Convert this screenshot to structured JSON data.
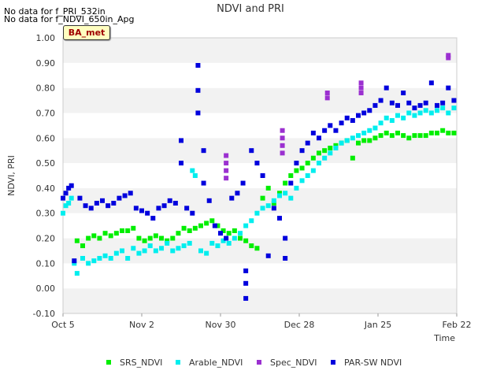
{
  "messages": [
    "No data for f_PRI_532in",
    "No data for f_NDVI_650in_Apg"
  ],
  "badge": "BA_met",
  "chart_data": {
    "type": "scatter",
    "title": "NDVI and PRI",
    "xlabel": "Time",
    "ylabel": "NDVI, PRI",
    "x_range": [
      "2023-10-05",
      "2024-02-22"
    ],
    "x_tick_labels": [
      "Oct 5",
      "Nov 2",
      "Nov 30",
      "Dec 28",
      "Jan 25",
      "Feb 22"
    ],
    "ylim": [
      -0.1,
      1.0
    ],
    "y_ticks": [
      -0.1,
      0.0,
      0.1,
      0.2,
      0.3,
      0.4,
      0.5,
      0.6,
      0.7,
      0.8,
      0.9,
      1.0
    ],
    "y_tick_labels": [
      "-0.10",
      "0.00",
      "0.10",
      "0.20",
      "0.30",
      "0.40",
      "0.50",
      "0.60",
      "0.70",
      "0.80",
      "0.90",
      "1.00"
    ],
    "grid": "horizontal bands",
    "legend_position": "bottom",
    "series": [
      {
        "name": "SRS_NDVI",
        "color": "#00ee00",
        "points": [
          [
            "2023-10-10",
            0.19
          ],
          [
            "2023-10-12",
            0.17
          ],
          [
            "2023-10-14",
            0.2
          ],
          [
            "2023-10-16",
            0.21
          ],
          [
            "2023-10-18",
            0.2
          ],
          [
            "2023-10-20",
            0.22
          ],
          [
            "2023-10-22",
            0.21
          ],
          [
            "2023-10-24",
            0.22
          ],
          [
            "2023-10-26",
            0.23
          ],
          [
            "2023-10-28",
            0.23
          ],
          [
            "2023-10-30",
            0.24
          ],
          [
            "2023-11-01",
            0.2
          ],
          [
            "2023-11-03",
            0.19
          ],
          [
            "2023-11-05",
            0.2
          ],
          [
            "2023-11-07",
            0.21
          ],
          [
            "2023-11-09",
            0.2
          ],
          [
            "2023-11-11",
            0.19
          ],
          [
            "2023-11-13",
            0.2
          ],
          [
            "2023-11-15",
            0.22
          ],
          [
            "2023-11-17",
            0.24
          ],
          [
            "2023-11-19",
            0.23
          ],
          [
            "2023-11-21",
            0.24
          ],
          [
            "2023-11-23",
            0.25
          ],
          [
            "2023-11-25",
            0.26
          ],
          [
            "2023-11-27",
            0.27
          ],
          [
            "2023-11-29",
            0.25
          ],
          [
            "2023-12-01",
            0.23
          ],
          [
            "2023-12-03",
            0.22
          ],
          [
            "2023-12-05",
            0.23
          ],
          [
            "2023-12-07",
            0.2
          ],
          [
            "2023-12-09",
            0.19
          ],
          [
            "2023-12-11",
            0.17
          ],
          [
            "2023-12-13",
            0.16
          ],
          [
            "2023-12-15",
            0.36
          ],
          [
            "2023-12-17",
            0.4
          ],
          [
            "2023-12-19",
            0.34
          ],
          [
            "2023-12-21",
            0.38
          ],
          [
            "2023-12-23",
            0.42
          ],
          [
            "2023-12-25",
            0.45
          ],
          [
            "2023-12-27",
            0.47
          ],
          [
            "2023-12-29",
            0.48
          ],
          [
            "2023-12-31",
            0.5
          ],
          [
            "2024-01-02",
            0.52
          ],
          [
            "2024-01-04",
            0.54
          ],
          [
            "2024-01-06",
            0.55
          ],
          [
            "2024-01-08",
            0.56
          ],
          [
            "2024-01-10",
            0.57
          ],
          [
            "2024-01-12",
            0.58
          ],
          [
            "2024-01-14",
            0.59
          ],
          [
            "2024-01-16",
            0.52
          ],
          [
            "2024-01-18",
            0.58
          ],
          [
            "2024-01-20",
            0.59
          ],
          [
            "2024-01-22",
            0.59
          ],
          [
            "2024-01-24",
            0.6
          ],
          [
            "2024-01-26",
            0.61
          ],
          [
            "2024-01-28",
            0.62
          ],
          [
            "2024-01-30",
            0.61
          ],
          [
            "2024-02-01",
            0.62
          ],
          [
            "2024-02-03",
            0.61
          ],
          [
            "2024-02-05",
            0.6
          ],
          [
            "2024-02-07",
            0.61
          ],
          [
            "2024-02-09",
            0.61
          ],
          [
            "2024-02-11",
            0.61
          ],
          [
            "2024-02-13",
            0.62
          ],
          [
            "2024-02-15",
            0.62
          ],
          [
            "2024-02-17",
            0.63
          ],
          [
            "2024-02-19",
            0.62
          ],
          [
            "2024-02-21",
            0.62
          ]
        ]
      },
      {
        "name": "Arable_NDVI",
        "color": "#00eeee",
        "points": [
          [
            "2023-10-05",
            0.3
          ],
          [
            "2023-10-06",
            0.33
          ],
          [
            "2023-10-07",
            0.34
          ],
          [
            "2023-10-08",
            0.36
          ],
          [
            "2023-10-09",
            0.1
          ],
          [
            "2023-10-10",
            0.06
          ],
          [
            "2023-10-12",
            0.12
          ],
          [
            "2023-10-14",
            0.1
          ],
          [
            "2023-10-16",
            0.11
          ],
          [
            "2023-10-18",
            0.12
          ],
          [
            "2023-10-20",
            0.13
          ],
          [
            "2023-10-22",
            0.12
          ],
          [
            "2023-10-24",
            0.14
          ],
          [
            "2023-10-26",
            0.15
          ],
          [
            "2023-10-28",
            0.12
          ],
          [
            "2023-10-30",
            0.16
          ],
          [
            "2023-11-01",
            0.14
          ],
          [
            "2023-11-03",
            0.15
          ],
          [
            "2023-11-05",
            0.17
          ],
          [
            "2023-11-07",
            0.15
          ],
          [
            "2023-11-09",
            0.16
          ],
          [
            "2023-11-11",
            0.18
          ],
          [
            "2023-11-13",
            0.15
          ],
          [
            "2023-11-15",
            0.16
          ],
          [
            "2023-11-17",
            0.17
          ],
          [
            "2023-11-19",
            0.18
          ],
          [
            "2023-11-20",
            0.47
          ],
          [
            "2023-11-21",
            0.45
          ],
          [
            "2023-11-23",
            0.15
          ],
          [
            "2023-11-25",
            0.14
          ],
          [
            "2023-11-27",
            0.18
          ],
          [
            "2023-11-29",
            0.17
          ],
          [
            "2023-12-01",
            0.19
          ],
          [
            "2023-12-03",
            0.18
          ],
          [
            "2023-12-05",
            0.2
          ],
          [
            "2023-12-07",
            0.22
          ],
          [
            "2023-12-09",
            0.25
          ],
          [
            "2023-12-11",
            0.27
          ],
          [
            "2023-12-13",
            0.3
          ],
          [
            "2023-12-15",
            0.32
          ],
          [
            "2023-12-17",
            0.33
          ],
          [
            "2023-12-19",
            0.35
          ],
          [
            "2023-12-21",
            0.37
          ],
          [
            "2023-12-23",
            0.38
          ],
          [
            "2023-12-25",
            0.36
          ],
          [
            "2023-12-27",
            0.4
          ],
          [
            "2023-12-29",
            0.43
          ],
          [
            "2023-12-31",
            0.45
          ],
          [
            "2024-01-02",
            0.47
          ],
          [
            "2024-01-04",
            0.5
          ],
          [
            "2024-01-06",
            0.52
          ],
          [
            "2024-01-08",
            0.54
          ],
          [
            "2024-01-10",
            0.56
          ],
          [
            "2024-01-12",
            0.58
          ],
          [
            "2024-01-14",
            0.59
          ],
          [
            "2024-01-16",
            0.6
          ],
          [
            "2024-01-18",
            0.61
          ],
          [
            "2024-01-20",
            0.62
          ],
          [
            "2024-01-22",
            0.63
          ],
          [
            "2024-01-24",
            0.64
          ],
          [
            "2024-01-26",
            0.66
          ],
          [
            "2024-01-28",
            0.68
          ],
          [
            "2024-01-30",
            0.67
          ],
          [
            "2024-02-01",
            0.69
          ],
          [
            "2024-02-03",
            0.68
          ],
          [
            "2024-02-05",
            0.7
          ],
          [
            "2024-02-07",
            0.69
          ],
          [
            "2024-02-09",
            0.7
          ],
          [
            "2024-02-11",
            0.71
          ],
          [
            "2024-02-13",
            0.7
          ],
          [
            "2024-02-15",
            0.71
          ],
          [
            "2024-02-17",
            0.72
          ],
          [
            "2024-02-19",
            0.7
          ],
          [
            "2024-02-21",
            0.72
          ]
        ]
      },
      {
        "name": "Spec_NDVI",
        "color": "#9b30d0",
        "points": [
          [
            "2023-12-02",
            0.53
          ],
          [
            "2023-12-02",
            0.5
          ],
          [
            "2023-12-02",
            0.47
          ],
          [
            "2023-12-02",
            0.44
          ],
          [
            "2023-12-22",
            0.63
          ],
          [
            "2023-12-22",
            0.6
          ],
          [
            "2023-12-22",
            0.57
          ],
          [
            "2023-12-22",
            0.54
          ],
          [
            "2024-01-07",
            0.78
          ],
          [
            "2024-01-07",
            0.76
          ],
          [
            "2024-01-19",
            0.82
          ],
          [
            "2024-01-19",
            0.8
          ],
          [
            "2024-01-19",
            0.78
          ],
          [
            "2024-02-19",
            0.93
          ],
          [
            "2024-02-19",
            0.92
          ]
        ]
      },
      {
        "name": "PAR-SW NDVI",
        "color": "#0000dd",
        "points": [
          [
            "2023-10-05",
            0.36
          ],
          [
            "2023-10-06",
            0.38
          ],
          [
            "2023-10-07",
            0.4
          ],
          [
            "2023-10-08",
            0.41
          ],
          [
            "2023-10-09",
            0.11
          ],
          [
            "2023-10-11",
            0.36
          ],
          [
            "2023-10-13",
            0.33
          ],
          [
            "2023-10-15",
            0.32
          ],
          [
            "2023-10-17",
            0.34
          ],
          [
            "2023-10-19",
            0.35
          ],
          [
            "2023-10-21",
            0.33
          ],
          [
            "2023-10-23",
            0.34
          ],
          [
            "2023-10-25",
            0.36
          ],
          [
            "2023-10-27",
            0.37
          ],
          [
            "2023-10-29",
            0.38
          ],
          [
            "2023-10-31",
            0.32
          ],
          [
            "2023-11-02",
            0.31
          ],
          [
            "2023-11-04",
            0.3
          ],
          [
            "2023-11-06",
            0.28
          ],
          [
            "2023-11-08",
            0.32
          ],
          [
            "2023-11-10",
            0.33
          ],
          [
            "2023-11-12",
            0.35
          ],
          [
            "2023-11-14",
            0.34
          ],
          [
            "2023-11-16",
            0.59
          ],
          [
            "2023-11-16",
            0.5
          ],
          [
            "2023-11-18",
            0.32
          ],
          [
            "2023-11-20",
            0.3
          ],
          [
            "2023-11-22",
            0.89
          ],
          [
            "2023-11-22",
            0.79
          ],
          [
            "2023-11-22",
            0.7
          ],
          [
            "2023-11-24",
            0.55
          ],
          [
            "2023-11-24",
            0.42
          ],
          [
            "2023-11-26",
            0.35
          ],
          [
            "2023-11-28",
            0.25
          ],
          [
            "2023-11-30",
            0.22
          ],
          [
            "2023-12-02",
            0.2
          ],
          [
            "2023-12-04",
            0.36
          ],
          [
            "2023-12-06",
            0.38
          ],
          [
            "2023-12-08",
            0.42
          ],
          [
            "2023-12-09",
            0.07
          ],
          [
            "2023-12-09",
            0.02
          ],
          [
            "2023-12-09",
            -0.04
          ],
          [
            "2023-12-11",
            0.55
          ],
          [
            "2023-12-13",
            0.5
          ],
          [
            "2023-12-15",
            0.45
          ],
          [
            "2023-12-17",
            0.13
          ],
          [
            "2023-12-19",
            0.32
          ],
          [
            "2023-12-21",
            0.28
          ],
          [
            "2023-12-23",
            0.12
          ],
          [
            "2023-12-23",
            0.2
          ],
          [
            "2023-12-25",
            0.42
          ],
          [
            "2023-12-27",
            0.5
          ],
          [
            "2023-12-29",
            0.55
          ],
          [
            "2023-12-31",
            0.58
          ],
          [
            "2024-01-02",
            0.62
          ],
          [
            "2024-01-04",
            0.6
          ],
          [
            "2024-01-06",
            0.63
          ],
          [
            "2024-01-08",
            0.65
          ],
          [
            "2024-01-10",
            0.63
          ],
          [
            "2024-01-12",
            0.66
          ],
          [
            "2024-01-14",
            0.68
          ],
          [
            "2024-01-16",
            0.67
          ],
          [
            "2024-01-18",
            0.69
          ],
          [
            "2024-01-20",
            0.7
          ],
          [
            "2024-01-22",
            0.71
          ],
          [
            "2024-01-24",
            0.73
          ],
          [
            "2024-01-26",
            0.75
          ],
          [
            "2024-01-28",
            0.8
          ],
          [
            "2024-01-30",
            0.74
          ],
          [
            "2024-02-01",
            0.73
          ],
          [
            "2024-02-03",
            0.78
          ],
          [
            "2024-02-05",
            0.74
          ],
          [
            "2024-02-07",
            0.72
          ],
          [
            "2024-02-09",
            0.73
          ],
          [
            "2024-02-11",
            0.74
          ],
          [
            "2024-02-13",
            0.82
          ],
          [
            "2024-02-15",
            0.73
          ],
          [
            "2024-02-17",
            0.74
          ],
          [
            "2024-02-19",
            0.8
          ],
          [
            "2024-02-21",
            0.75
          ]
        ]
      }
    ]
  }
}
